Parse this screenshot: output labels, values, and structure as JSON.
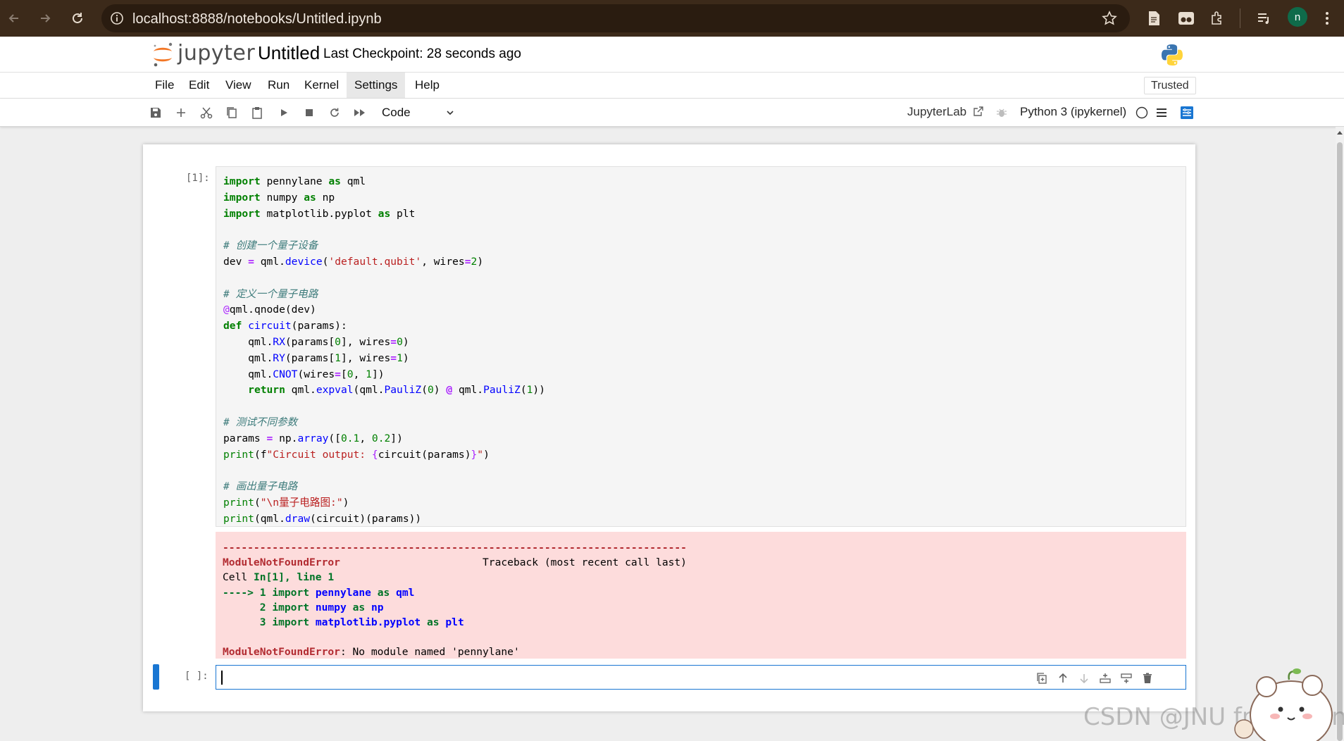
{
  "browser": {
    "url": "localhost:8888/notebooks/Untitled.ipynb",
    "avatar_letter": "n"
  },
  "header": {
    "logo_text": "jupyter",
    "notebook_title": "Untitled",
    "checkpoint": "Last Checkpoint: 28 seconds ago"
  },
  "menu": {
    "items": [
      "File",
      "Edit",
      "View",
      "Run",
      "Kernel",
      "Settings",
      "Help"
    ],
    "trusted_label": "Trusted"
  },
  "toolbar": {
    "cell_type": "Code",
    "jupyterlab_link": "JupyterLab",
    "kernel_name": "Python 3 (ipykernel)"
  },
  "cells": {
    "first_prompt": "[1]:",
    "second_prompt": "[ ]:"
  },
  "watermark": "CSDN @JNU freshman",
  "colors": {
    "accent": "#1976d2",
    "error_bg": "#fddcdc",
    "browser_bar": "#3c2a1a"
  }
}
